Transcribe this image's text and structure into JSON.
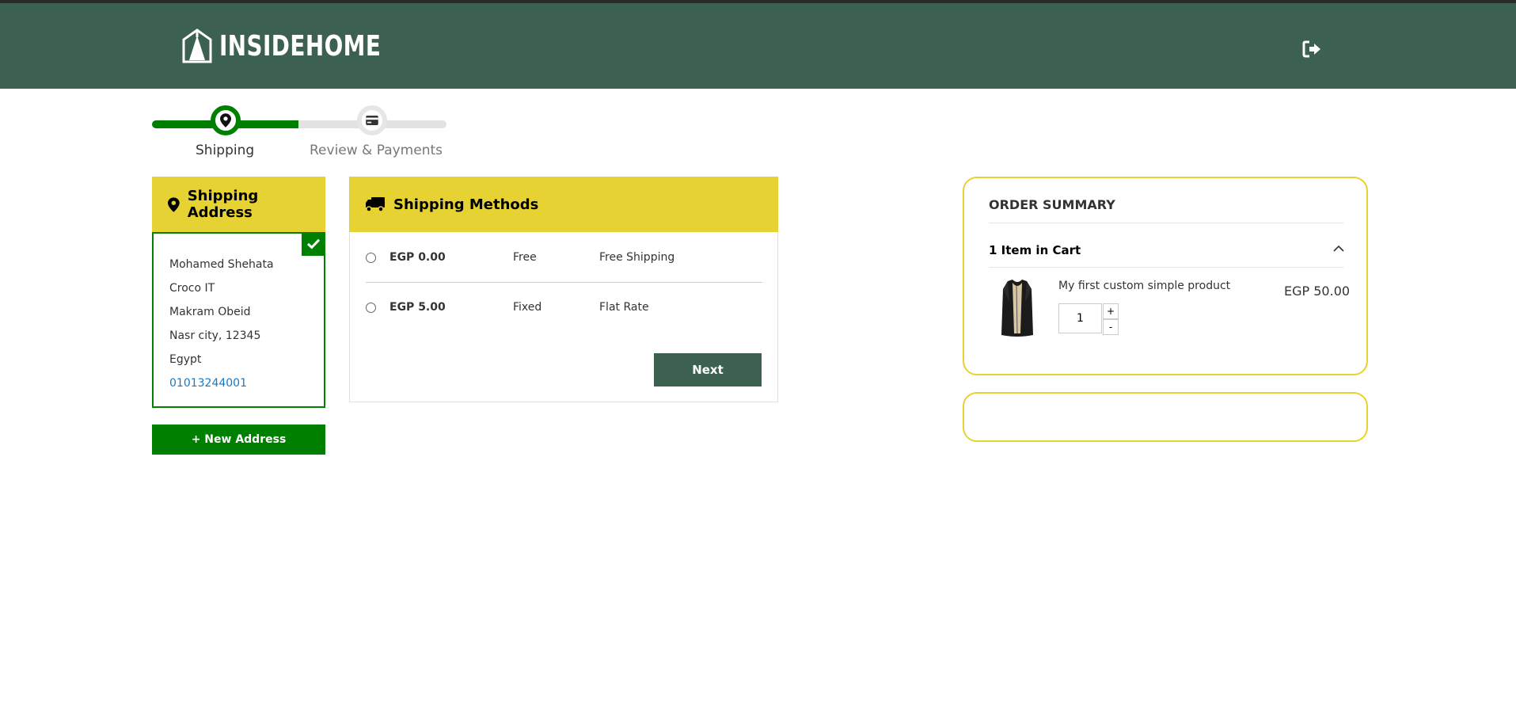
{
  "header": {
    "brand": "INSIDEHOME",
    "logout_icon": "sign-out-icon",
    "background": "#3d6150"
  },
  "progress": {
    "steps": [
      {
        "label": "Shipping",
        "icon": "map-marker-icon",
        "active": true
      },
      {
        "label": "Review & Payments",
        "icon": "credit-card-icon",
        "active": false
      }
    ],
    "accent": "#008000"
  },
  "shipping_address": {
    "title": "Shipping Address",
    "icon": "map-marker-icon",
    "selected": true,
    "lines": [
      "Mohamed Shehata",
      "Croco IT",
      "Makram Obeid",
      "Nasr city, 12345",
      "Egypt"
    ],
    "phone": "01013244001",
    "new_address_label": "+ New Address"
  },
  "shipping_methods": {
    "title": "Shipping Methods",
    "icon": "truck-icon",
    "options": [
      {
        "price": "EGP 0.00",
        "type": "Free",
        "name": "Free Shipping",
        "selected": false
      },
      {
        "price": "EGP 5.00",
        "type": "Fixed",
        "name": "Flat Rate",
        "selected": false
      }
    ],
    "next_label": "Next",
    "header_color": "#e6d232"
  },
  "order_summary": {
    "title": "ORDER SUMMARY",
    "cart_count": "1 Item in Cart",
    "expanded": true,
    "items": [
      {
        "name": "My first custom simple product",
        "price": "EGP 50.00",
        "qty": "1",
        "plus": "+",
        "minus": "-"
      }
    ]
  }
}
